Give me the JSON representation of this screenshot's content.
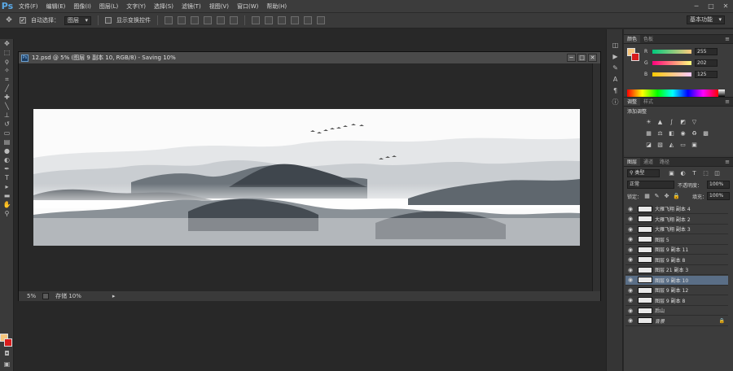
{
  "app": {
    "logo": "Ps"
  },
  "menu": [
    "文件(F)",
    "编辑(E)",
    "图像(I)",
    "图层(L)",
    "文字(Y)",
    "选择(S)",
    "滤镜(T)",
    "视图(V)",
    "窗口(W)",
    "帮助(H)"
  ],
  "window_controls": {
    "min": "─",
    "max": "□",
    "close": "✕"
  },
  "options": {
    "auto_select_label": "自动选择：",
    "auto_select_value": "图层",
    "show_transform_label": "显示变换控件",
    "workspace": "基本功能"
  },
  "document": {
    "title": "12.psd @ 5% (图层 9 副本 10, RGB/8) - Saving 10%",
    "zoom": "5%",
    "status": "存储 10%"
  },
  "color_panel": {
    "tabs": [
      "颜色",
      "色板"
    ],
    "r_label": "R",
    "g_label": "G",
    "b_label": "B",
    "r": "255",
    "g": "202",
    "b": "125",
    "fg": "#f6c67d",
    "bg": "#d81c1c"
  },
  "adjust_panel": {
    "tabs": [
      "调整",
      "样式"
    ],
    "title": "添加调整"
  },
  "layers_panel": {
    "tabs": [
      "图层",
      "通道",
      "路径"
    ],
    "filter": "类型",
    "blend_mode": "正常",
    "opacity_label": "不透明度：",
    "opacity": "100%",
    "lock_label": "锁定：",
    "fill_label": "填充：",
    "fill": "100%",
    "layers": [
      {
        "name": "大雁飞翔 副本 4",
        "selected": false
      },
      {
        "name": "大雁飞翔 副本 2",
        "selected": false
      },
      {
        "name": "大雁飞翔 副本 3",
        "selected": false
      },
      {
        "name": "图层 5",
        "selected": false
      },
      {
        "name": "图层 9 副本 11",
        "selected": false
      },
      {
        "name": "图层 9 副本 8",
        "selected": false
      },
      {
        "name": "图层 21 副本 3",
        "selected": false
      },
      {
        "name": "图层 9 副本 10",
        "selected": true
      },
      {
        "name": "图层 9 副本 12",
        "selected": false
      },
      {
        "name": "图层 9 副本 8",
        "selected": false
      },
      {
        "name": "后山",
        "selected": false
      },
      {
        "name": "背景",
        "selected": false,
        "locked": true
      }
    ]
  }
}
